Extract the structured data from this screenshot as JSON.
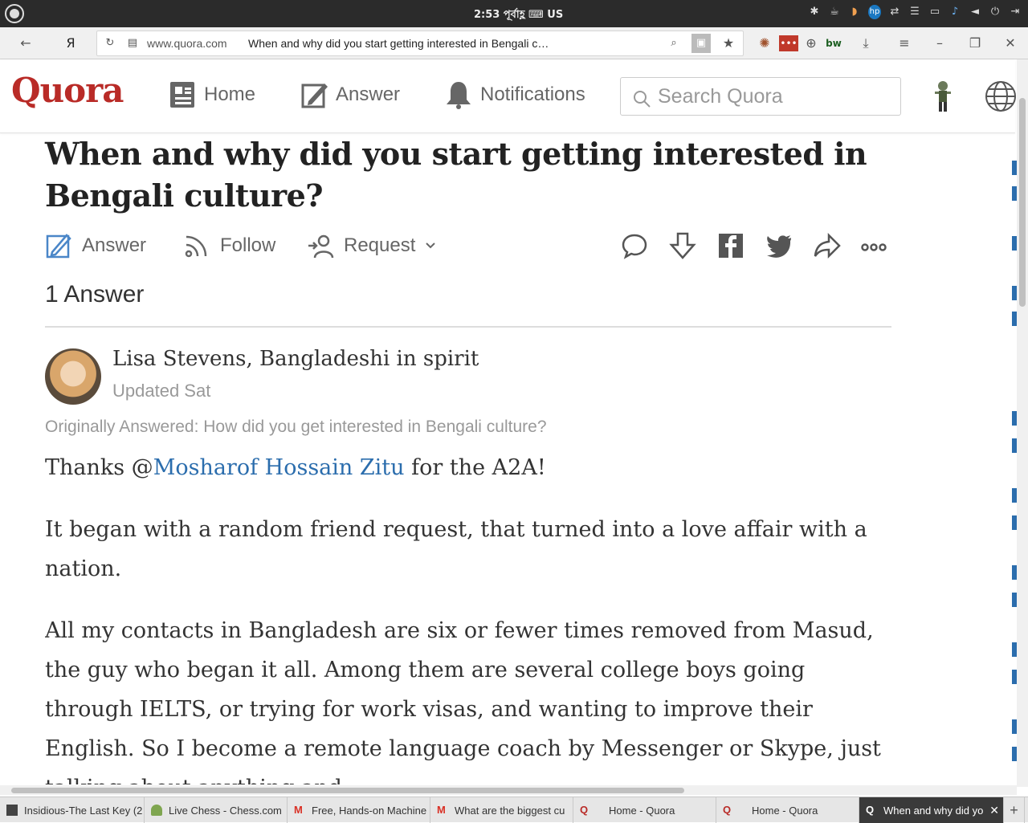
{
  "system": {
    "clock": "2:53 পূর্বাহ্ণ ⌨ US",
    "tray_icons": [
      "bulb-icon",
      "cup-icon",
      "melon-icon",
      "hp-icon",
      "sync-icon",
      "list-icon",
      "folder-icon",
      "bell-icon",
      "volume-icon",
      "power-icon",
      "exit-icon"
    ]
  },
  "browser": {
    "url_domain": "www.quora.com",
    "page_title": "When and why did you start getting interested in Bengali c…"
  },
  "header": {
    "logo": "Quora",
    "nav": [
      {
        "label": "Home"
      },
      {
        "label": "Answer"
      },
      {
        "label": "Notifications"
      }
    ],
    "search_placeholder": "Search Quora"
  },
  "question": {
    "title": "When and why did you start getting interested in Bengali culture?",
    "actions": {
      "answer": "Answer",
      "follow": "Follow",
      "request": "Request"
    },
    "answers_count": "1 Answer"
  },
  "answer": {
    "author": "Lisa Stevens, Bangladeshi in spirit",
    "updated": "Updated Sat",
    "originally": "Originally Answered: How did you get interested in Bengali culture?",
    "thanks_prefix": "Thanks @",
    "thanks_link": "Mosharof Hossain Zitu",
    "thanks_suffix": " for the A2A!",
    "para1": "It began with a random friend request, that turned into a love affair with a nation.",
    "para2": "All my contacts in Bangladesh are six or fewer times removed from Masud, the guy who began it all. Among them are several college boys going through IELTS, or trying for work visas, and wanting to improve their English. So I become a remote language coach by Messenger or Skype, just talking about anything and"
  },
  "taskbar": {
    "tabs": [
      {
        "label": "Insidious-The Last Key (2"
      },
      {
        "label": "Live Chess - Chess.com"
      },
      {
        "label": "Free, Hands-on Machine"
      },
      {
        "label": "What are the biggest cu"
      },
      {
        "label": "Home - Quora"
      },
      {
        "label": "Home - Quora"
      },
      {
        "label": "When and why did yo"
      }
    ]
  },
  "colors": {
    "brand": "#b92b27",
    "link": "#2b6dad"
  }
}
